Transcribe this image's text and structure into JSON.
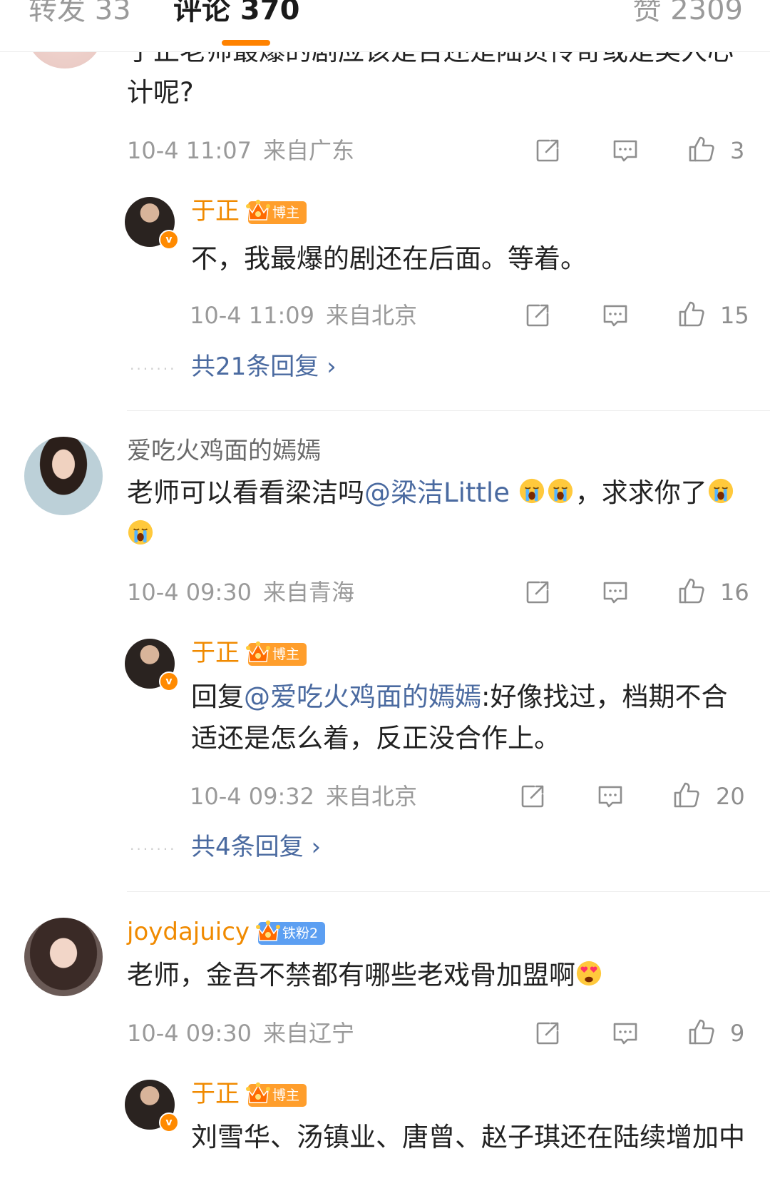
{
  "tabs": {
    "repost": "转发 33",
    "comments": "评论 370",
    "likes": "赞 2309"
  },
  "comment1": {
    "text": "于正老师最爆的剧应该是否还是陆贞传奇或是美人心计呢?",
    "time": "10-4 11:07",
    "location": "来自广东",
    "likes": "3",
    "reply": {
      "user": "于正",
      "badge": "博主",
      "text": "不，我最爆的剧还在后面。等着。",
      "time": "10-4 11:09",
      "location": "来自北京",
      "likes": "15"
    },
    "more_replies": "共21条回复"
  },
  "comment2": {
    "user": "爱吃火鸡面的嫣嫣",
    "text_before": "老师可以看看梁洁吗",
    "mention": "@梁洁Little",
    "text_after": "，求求你了",
    "time": "10-4 09:30",
    "location": "来自青海",
    "likes": "16",
    "reply": {
      "user": "于正",
      "badge": "博主",
      "prefix": "回复",
      "mention": "@爱吃火鸡面的嫣嫣",
      "text": ":好像找过，档期不合适还是怎么着，反正没合作上。",
      "time": "10-4 09:32",
      "location": "来自北京",
      "likes": "20"
    },
    "more_replies": "共4条回复"
  },
  "comment3": {
    "user": "joydajuicy",
    "badge": "铁粉2",
    "text": "老师，金吾不禁都有哪些老戏骨加盟啊",
    "time": "10-4 09:30",
    "location": "来自辽宁",
    "likes": "9",
    "reply": {
      "user": "于正",
      "badge": "博主",
      "text": "刘雪华、汤镇业、唐曾、赵子琪还在陆续增加中"
    }
  },
  "colors": {
    "accent": "#ff8200",
    "username_orange": "#f08a00",
    "link_blue": "#4a6aa0",
    "meta_gray": "#9a9a9a"
  },
  "icons": [
    "share-icon",
    "comment-icon",
    "like-icon",
    "crown-icon",
    "verified-icon",
    "crying-emoji",
    "heart-eyes-emoji"
  ]
}
